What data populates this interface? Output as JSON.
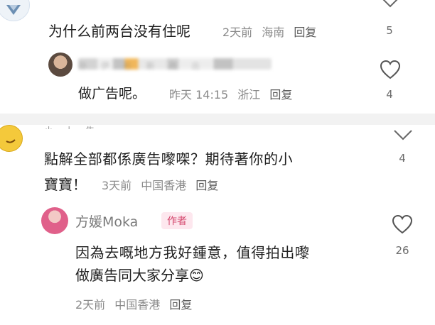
{
  "comment1": {
    "text": "为什么前两台没有住呢",
    "time": "2天前",
    "location": "海南",
    "reply_label": "回复",
    "likes": "5"
  },
  "reply1": {
    "obscured_name": "孙 伊 杉 新 政 出",
    "text": "做广告呢。",
    "time": "昨天 14:15",
    "location": "浙江",
    "reply_label": "回复",
    "likes": "4"
  },
  "comment2": {
    "partial_username": "小 上 告",
    "text_line1": "點解全部都係廣告嚟㗎？期待著你的小",
    "text_line2": "寶寶！",
    "time": "3天前",
    "location": "中国香港",
    "reply_label": "回复",
    "likes": "4"
  },
  "reply2": {
    "username": "方媛Moka",
    "badge": "作者",
    "text_line1": "因為去嘅地方我好鍾意，值得拍出嚟",
    "text_line2": "做廣告同大家分享😊",
    "time": "2天前",
    "location": "中国香港",
    "reply_label": "回复",
    "likes": "26"
  },
  "colors": {
    "divider": "#f2f2f2",
    "author_badge_bg": "#fde7ee",
    "author_badge_text": "#d4476d",
    "meta_text": "#8a8a8a"
  },
  "icons": [
    "heart-outline-icon",
    "chevron-down-icon",
    "avatar"
  ]
}
